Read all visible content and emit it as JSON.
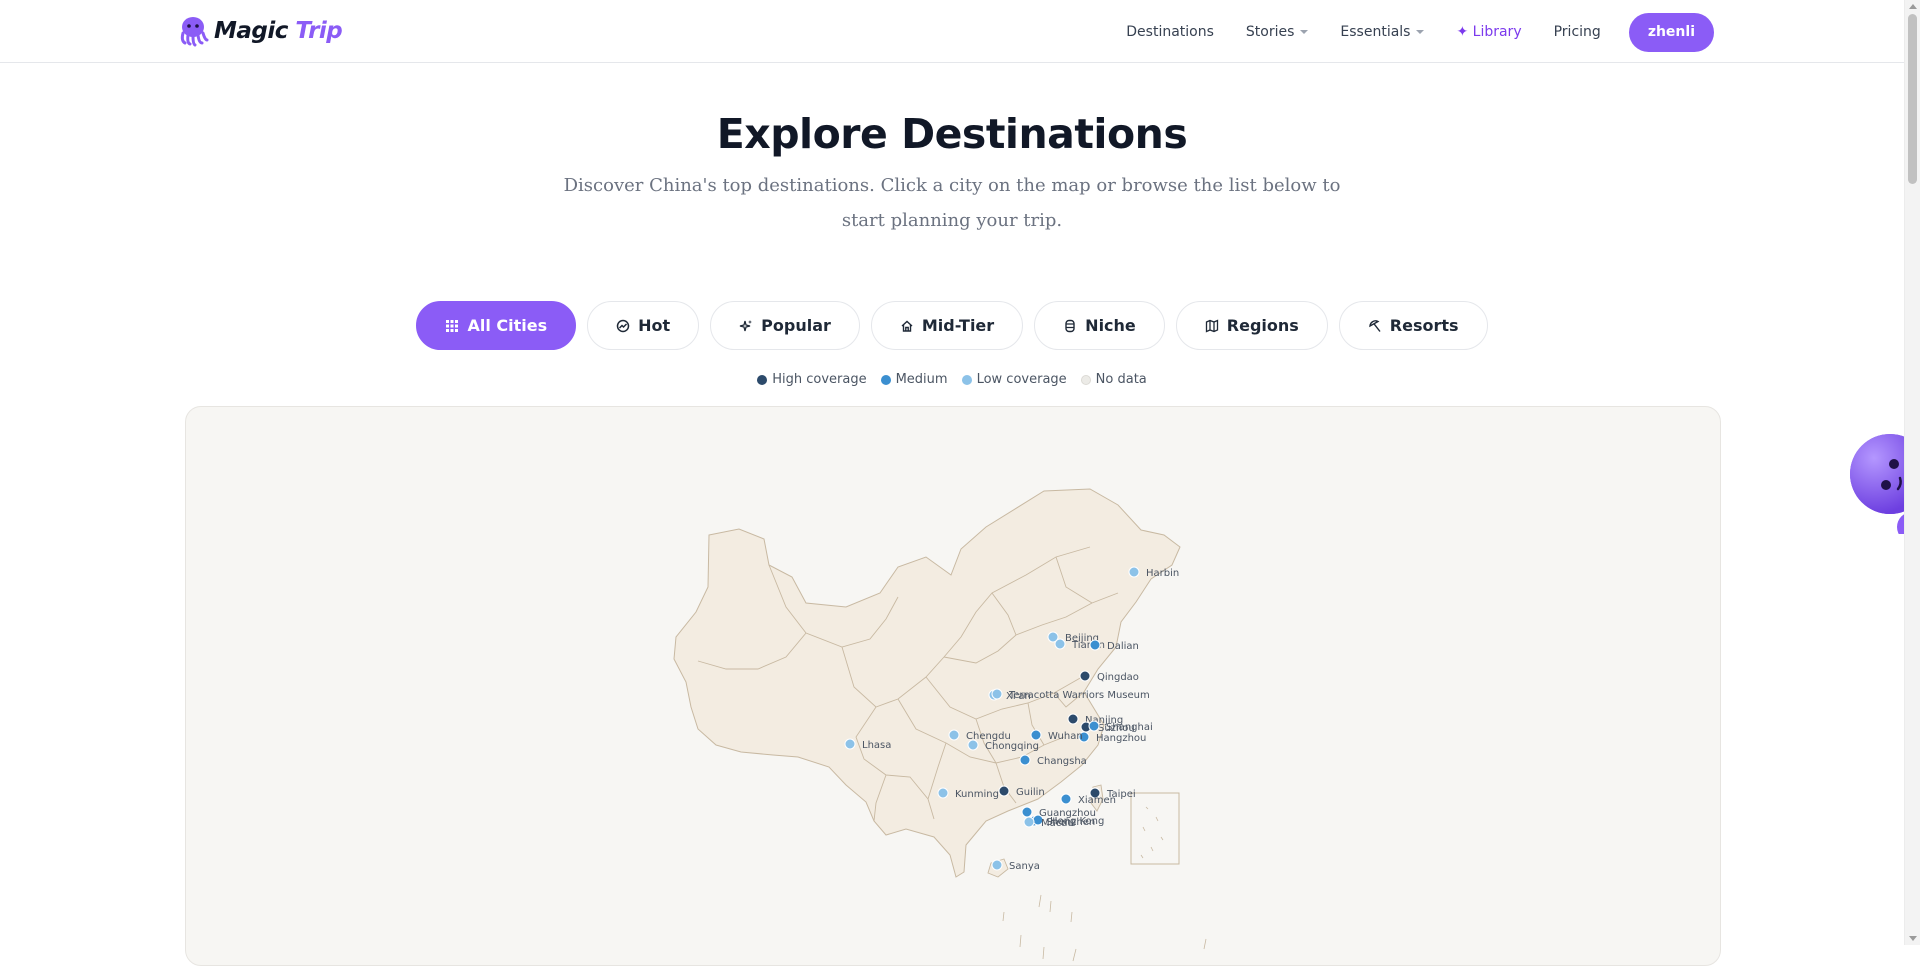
{
  "brand": {
    "name_part1": "Magic",
    "name_part2": "Trip"
  },
  "nav": {
    "destinations": "Destinations",
    "stories": "Stories",
    "essentials": "Essentials",
    "library": "✦ Library",
    "pricing": "Pricing",
    "user": "zhenli"
  },
  "hero": {
    "title": "Explore Destinations",
    "subtitle": "Discover China's top destinations. Click a city on the map or browse the list below to start planning your trip."
  },
  "filters": [
    {
      "label": "All Cities",
      "icon": "grid-icon",
      "active": true
    },
    {
      "label": "Hot",
      "icon": "trending-icon",
      "active": false
    },
    {
      "label": "Popular",
      "icon": "sparkle-icon",
      "active": false
    },
    {
      "label": "Mid-Tier",
      "icon": "home-icon",
      "active": false
    },
    {
      "label": "Niche",
      "icon": "gem-icon",
      "active": false
    },
    {
      "label": "Regions",
      "icon": "map-icon",
      "active": false
    },
    {
      "label": "Resorts",
      "icon": "umbrella-icon",
      "active": false
    }
  ],
  "legend": [
    {
      "label": "High coverage",
      "color": "#2c4a6b"
    },
    {
      "label": "Medium",
      "color": "#3b8fd0"
    },
    {
      "label": "Low coverage",
      "color": "#8cc2e8"
    },
    {
      "label": "No data",
      "color": "#ecebe7"
    }
  ],
  "colors": {
    "accent": "#8b5cf6",
    "map_land": "#f3ece1",
    "map_border": "#c8b9a2",
    "high": "#2c4a6b",
    "medium": "#3b8fd0",
    "low": "#8cc2e8"
  },
  "cities": [
    {
      "name": "Harbin",
      "level": "low"
    },
    {
      "name": "Beijing",
      "level": "low"
    },
    {
      "name": "Tianjin",
      "level": "low"
    },
    {
      "name": "Dalian",
      "level": "medium"
    },
    {
      "name": "Qingdao",
      "level": "high"
    },
    {
      "name": "Xi'an",
      "level": "low"
    },
    {
      "name": "Terracotta Warriors Museum",
      "level": "low"
    },
    {
      "name": "Nanjing",
      "level": "high"
    },
    {
      "name": "Suzhou",
      "level": "high"
    },
    {
      "name": "Shanghai",
      "level": "medium"
    },
    {
      "name": "Hangzhou",
      "level": "medium"
    },
    {
      "name": "Lhasa",
      "level": "low"
    },
    {
      "name": "Chengdu",
      "level": "low"
    },
    {
      "name": "Chongqing",
      "level": "low"
    },
    {
      "name": "Wuhan",
      "level": "medium"
    },
    {
      "name": "Changsha",
      "level": "medium"
    },
    {
      "name": "Kunming",
      "level": "low"
    },
    {
      "name": "Guilin",
      "level": "high"
    },
    {
      "name": "Taipei",
      "level": "high"
    },
    {
      "name": "Xiamen",
      "level": "medium"
    },
    {
      "name": "Guangzhou",
      "level": "medium"
    },
    {
      "name": "Shenzhen",
      "level": "medium"
    },
    {
      "name": "Hong Kong",
      "level": "medium"
    },
    {
      "name": "Macau",
      "level": "low"
    },
    {
      "name": "Sanya",
      "level": "low"
    }
  ]
}
